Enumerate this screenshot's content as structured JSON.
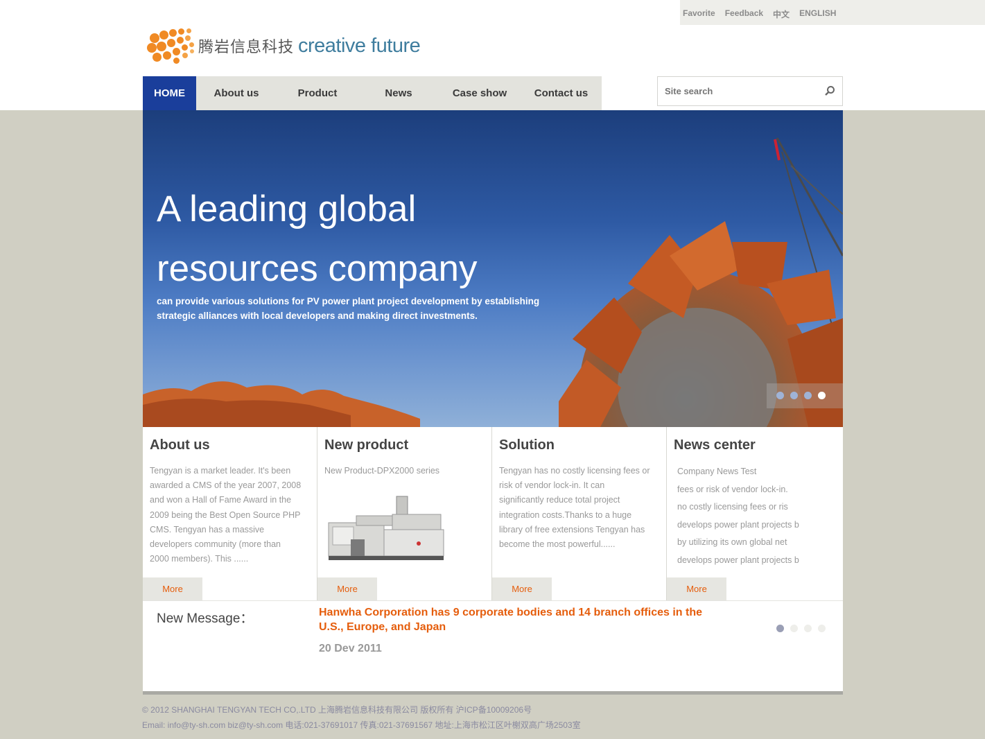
{
  "toplinks": {
    "favorite": "Favorite",
    "feedback": "Feedback",
    "chinese": "中文",
    "english": "ENGLISH"
  },
  "logo": {
    "name": "腾岩信息科技",
    "tagline": "creative future"
  },
  "nav": [
    "HOME",
    "About us",
    "Product",
    "News",
    "Case show",
    "Contact us"
  ],
  "search": {
    "placeholder": "Site search"
  },
  "hero": {
    "headline": "A leading global resources company",
    "subtext": "can provide various solutions for PV power plant project development by establishing strategic alliances with local developers and making direct investments.",
    "active_slide": 4,
    "slide_count": 4
  },
  "columns": {
    "about": {
      "title": "About us",
      "text": "Tengyan is a market leader. It's been awarded a CMS of the year 2007, 2008 and won a Hall of Fame Award in the 2009 being the Best Open Source PHP CMS. Tengyan has a massive developers community (more than 2000 members). This ......",
      "more": "More"
    },
    "product": {
      "title": "New product",
      "text": "New Product-DPX2000 series",
      "more": "More"
    },
    "solution": {
      "title": "Solution",
      "text": "Tengyan has no costly licensing fees or risk of vendor lock-in. It can significantly reduce total project integration costs.Thanks to a huge library of free extensions Tengyan has become the most powerful......",
      "more": "More"
    },
    "news": {
      "title": "News center",
      "items": [
        "Company News Test",
        "fees or risk of vendor lock-in.",
        "no costly licensing fees or ris",
        "develops power plant projects b",
        "by utilizing its own global net",
        "develops power plant projects b"
      ],
      "more": "More"
    }
  },
  "message": {
    "label": "New Message：",
    "headline": "Hanwha Corporation has 9 corporate bodies and 14 branch offices in the U.S., Europe, and Japan",
    "date": "20 Dev 2011",
    "active_page": 1,
    "page_count": 4
  },
  "footer": {
    "line1": "© 2012 SHANGHAI TENGYAN TECH CO,.LTD 上海腾岩信息科技有限公司 版权所有 沪ICP备10009206号",
    "line2": "Email: info@ty-sh.com biz@ty-sh.com 电话:021-37691017 传真:021-37691567 地址:上海市松江区叶榭双高广场2503室"
  },
  "colors": {
    "nav_active": "#1a3e9b",
    "accent_orange": "#e55d0c",
    "page_bg": "#d0cfc3"
  }
}
